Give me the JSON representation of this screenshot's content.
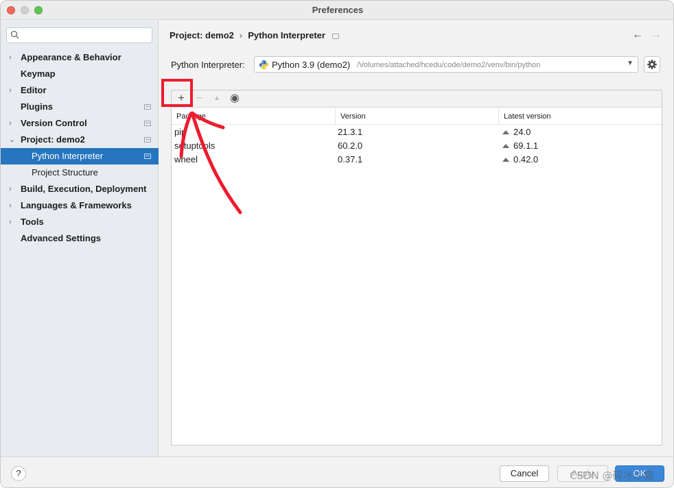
{
  "window": {
    "title": "Preferences"
  },
  "sidebar": {
    "search_placeholder": "",
    "items": [
      {
        "label": "Appearance & Behavior",
        "arrow": "›"
      },
      {
        "label": "Keymap"
      },
      {
        "label": "Editor",
        "arrow": "›"
      },
      {
        "label": "Plugins"
      },
      {
        "label": "Version Control",
        "arrow": "›"
      },
      {
        "label": "Project: demo2",
        "arrow": "⌄"
      },
      {
        "label": "Python Interpreter"
      },
      {
        "label": "Project Structure"
      },
      {
        "label": "Build, Execution, Deployment",
        "arrow": "›"
      },
      {
        "label": "Languages & Frameworks",
        "arrow": "›"
      },
      {
        "label": "Tools",
        "arrow": "›"
      },
      {
        "label": "Advanced Settings"
      }
    ]
  },
  "breadcrumb": {
    "project": "Project: demo2",
    "separator": "›",
    "page": "Python Interpreter"
  },
  "nav": {
    "back": "←",
    "forward": "→"
  },
  "interpreter": {
    "label": "Python Interpreter:",
    "name": "Python 3.9 (demo2)",
    "path": "/Volumes/attached/hcedu/code/demo2/venv/bin/python"
  },
  "toolbar": {
    "add": "+",
    "remove": "−",
    "upgrade": "▲",
    "show_early": "◉"
  },
  "packages": {
    "columns": [
      "Package",
      "Version",
      "Latest version"
    ],
    "rows": [
      {
        "package": "pip",
        "version": "21.3.1",
        "latest": "24.0"
      },
      {
        "package": "setuptools",
        "version": "60.2.0",
        "latest": "69.1.1"
      },
      {
        "package": "wheel",
        "version": "0.37.1",
        "latest": "0.42.0"
      }
    ]
  },
  "footer": {
    "help": "?",
    "cancel": "Cancel",
    "apply": "Apply",
    "ok": "OK"
  },
  "watermark": "CSDN @碎冰沙糖",
  "colors": {
    "selection": "#2675bf",
    "annotation": "#ee1b2e",
    "ok_button": "#3b87d9"
  }
}
